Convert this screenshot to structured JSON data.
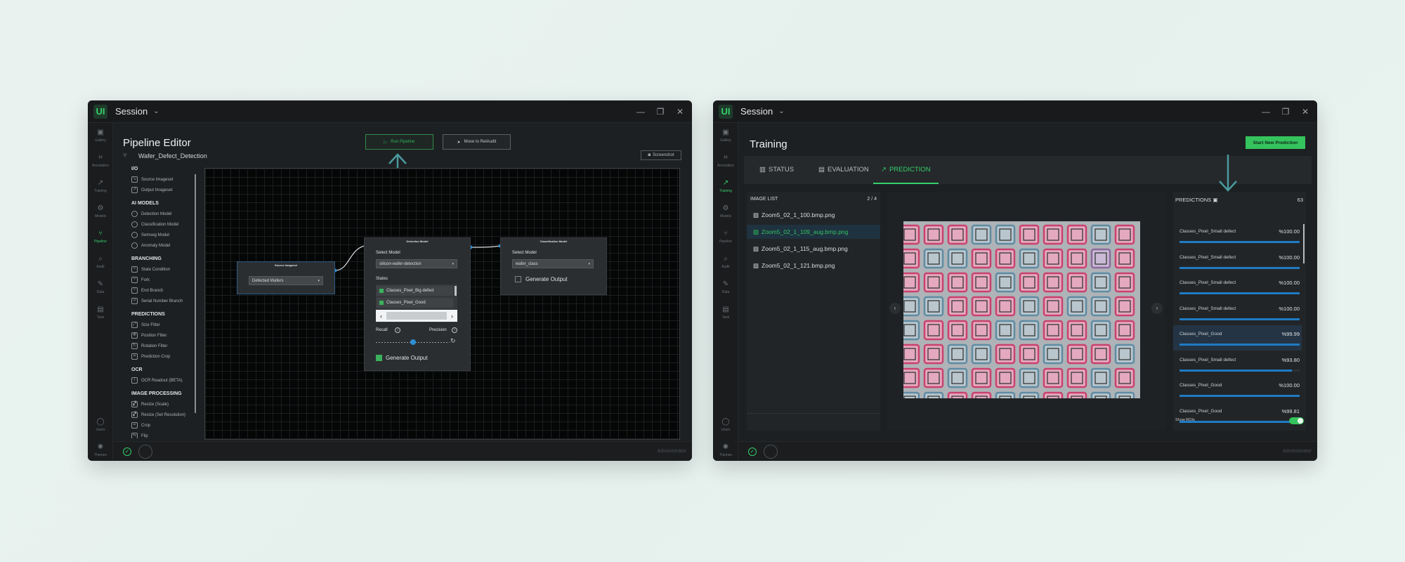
{
  "left_window": {
    "logo": "UI",
    "session": "Session",
    "title": "Pipeline Editor",
    "file_name": "Wafer_Defect_Detection",
    "buttons": {
      "run": "Run Pipeline",
      "move": "Move to RelAudit",
      "screenshot": "Screenshot"
    },
    "rail": [
      "Gallery",
      "Annotation",
      "Training",
      "Models",
      "Pipeline",
      "Audit",
      "Data",
      "Task"
    ],
    "rail_bottom": [
      "Users",
      "Themes"
    ],
    "panel": {
      "sections": [
        {
          "title": "I/O",
          "items": [
            "Source Imageset",
            "Output Imageset"
          ]
        },
        {
          "title": "AI MODELS",
          "items": [
            "Detection Model",
            "Classification Model",
            "Semseg Model",
            "Anomaly Model"
          ]
        },
        {
          "title": "BRANCHING",
          "items": [
            "State Condition",
            "Fork",
            "End Branch",
            "Serial Number Branch"
          ]
        },
        {
          "title": "PREDICTIONS",
          "items": [
            "Size Filter",
            "Position Filter",
            "Rotation Filter",
            "Prediction Crop"
          ]
        },
        {
          "title": "OCR",
          "items": [
            "OCR Readout (BETA)"
          ]
        },
        {
          "title": "IMAGE PROCESSING",
          "items": [
            "Resize (Scale)",
            "Resize (Set Resolution)",
            "Crop",
            "Flip"
          ]
        }
      ]
    },
    "nodes": {
      "source": {
        "title": "Source Imageset",
        "value": "Defected Wafers"
      },
      "detection": {
        "title": "Detection Model",
        "select_label": "Select Model",
        "model": "silicon-wafer-detection",
        "states_label": "States",
        "states": [
          "Classes_Pixel_Big defect",
          "Classes_Pixel_Good"
        ],
        "recall": "Recall",
        "precision": "Precision",
        "slider_value": 0.5,
        "output": "Generate Output",
        "output_checked": true
      },
      "classification": {
        "title": "Classification Model",
        "select_label": "Select Model",
        "model": "wafer_class",
        "output": "Generate Output",
        "output_checked": false
      }
    },
    "footer_user": "Administrator"
  },
  "right_window": {
    "logo": "UI",
    "session": "Session",
    "title": "Training",
    "new_prediction": "Start New Prediction",
    "rail": [
      "Gallery",
      "Annotation",
      "Training",
      "Models",
      "Pipeline",
      "Audit",
      "Data",
      "Task"
    ],
    "rail_bottom": [
      "Users",
      "Themes"
    ],
    "tabs": [
      "STATUS",
      "EVALUATION",
      "PREDICTION"
    ],
    "active_tab": "PREDICTION",
    "image_list": {
      "label": "IMAGE LIST",
      "count": "2 / 4",
      "items": [
        "Zoom5_02_1_100.bmp.png",
        "Zoom5_02_1_109_aug.bmp.png",
        "Zoom5_02_1_115_aug.bmp.png",
        "Zoom5_02_1_121.bmp.png"
      ],
      "selected_index": 1
    },
    "predictions": {
      "label": "PREDICTIONS",
      "count": "63",
      "items": [
        {
          "name": "Classes_Pixel_Small defect",
          "value": "%100.00",
          "fraction": 1.0
        },
        {
          "name": "Classes_Pixel_Small defect",
          "value": "%100.00",
          "fraction": 1.0
        },
        {
          "name": "Classes_Pixel_Small defect",
          "value": "%100.00",
          "fraction": 1.0
        },
        {
          "name": "Classes_Pixel_Small defect",
          "value": "%100.00",
          "fraction": 1.0
        },
        {
          "name": "Classes_Pixel_Good",
          "value": "%99.99",
          "fraction": 0.9999
        },
        {
          "name": "Classes_Pixel_Small defect",
          "value": "%93.80",
          "fraction": 0.938
        },
        {
          "name": "Classes_Pixel_Good",
          "value": "%100.00",
          "fraction": 1.0
        },
        {
          "name": "Classes_Pixel_Good",
          "value": "%99.81",
          "fraction": 0.9981
        }
      ],
      "selected_index": 4
    },
    "show_rois": "Show ROIs",
    "show_rois_on": true,
    "footer_user": "Administrator"
  },
  "colors": {
    "accent": "#35d06a",
    "arrow": "#4a9a9e",
    "defect": "#c9426d",
    "good": "#5e8ba3",
    "bar": "#1f7bc4"
  }
}
